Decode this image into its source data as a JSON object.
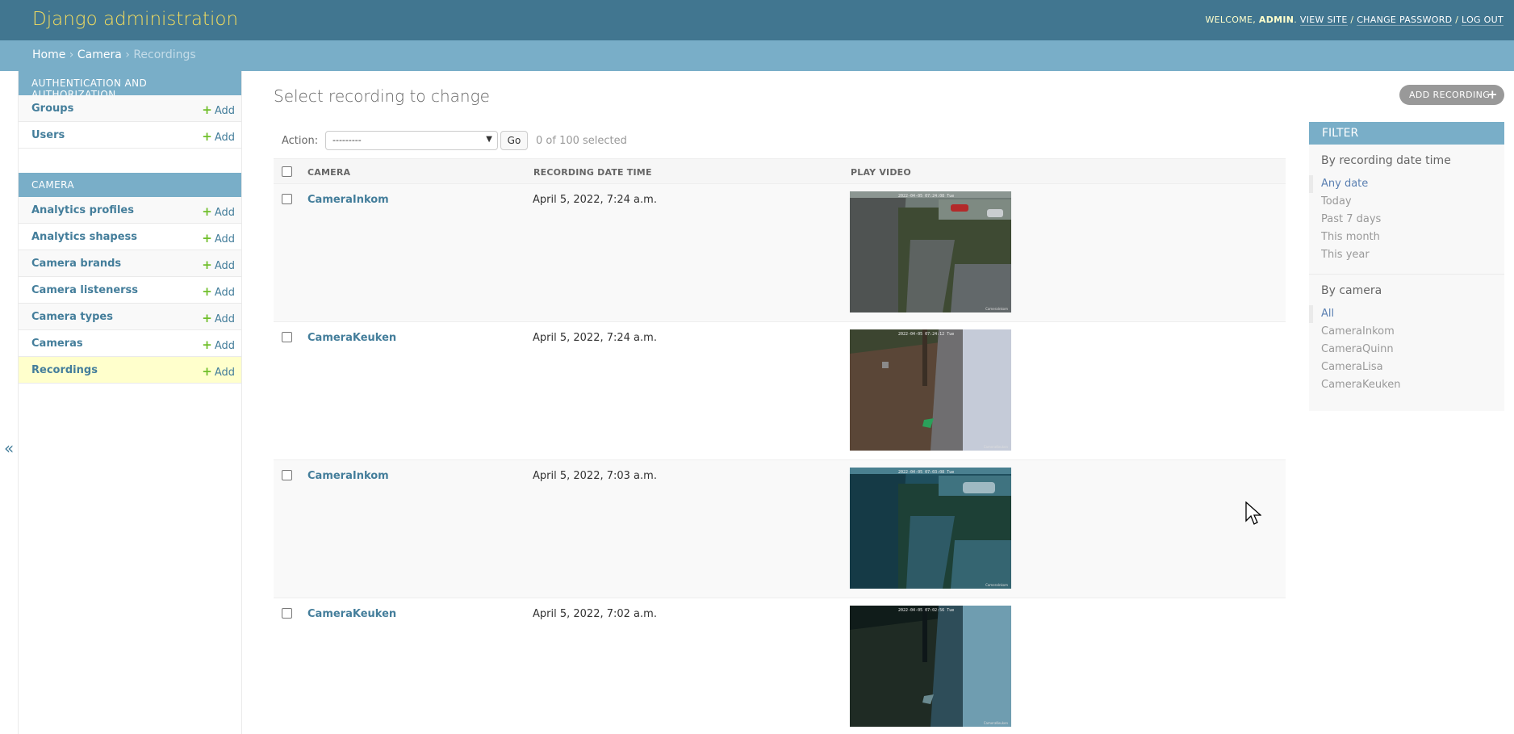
{
  "header": {
    "site_name": "Django administration",
    "welcome": "WELCOME,",
    "username": "ADMIN",
    "view_site": "VIEW SITE",
    "change_password": "CHANGE PASSWORD",
    "log_out": "LOG OUT",
    "separator": "/"
  },
  "breadcrumbs": {
    "home": "Home",
    "app": "Camera",
    "current": "Recordings",
    "sep": "›"
  },
  "nav_toggle": "«",
  "sidebar": {
    "add_label": "Add",
    "modules": [
      {
        "caption": "Authentication and Authorization",
        "models": [
          {
            "name": "Groups"
          },
          {
            "name": "Users"
          }
        ]
      },
      {
        "caption": "Camera",
        "models": [
          {
            "name": "Analytics profiles"
          },
          {
            "name": "Analytics shapess"
          },
          {
            "name": "Camera brands"
          },
          {
            "name": "Camera listenerss"
          },
          {
            "name": "Camera types"
          },
          {
            "name": "Cameras"
          },
          {
            "name": "Recordings",
            "current": true
          }
        ]
      }
    ]
  },
  "content": {
    "title": "Select recording to change",
    "add_button": "ADD RECORDING"
  },
  "actions": {
    "label": "Action:",
    "selected_option": "---------",
    "go_label": "Go",
    "selected_count": "0 of 100 selected"
  },
  "table": {
    "headers": [
      "CAMERA",
      "RECORDING DATE TIME",
      "PLAY VIDEO"
    ],
    "rows": [
      {
        "camera": "CameraInkom",
        "datetime": "April 5, 2022, 7:24 a.m.",
        "video_timestamp": "2022-04-05 07:24:08 Tue",
        "video_camera": "CameraInkom"
      },
      {
        "camera": "CameraKeuken",
        "datetime": "April 5, 2022, 7:24 a.m.",
        "video_timestamp": "2022-04-05 07:24:12 Tue",
        "video_camera": "CameraKeuken"
      },
      {
        "camera": "CameraInkom",
        "datetime": "April 5, 2022, 7:03 a.m.",
        "video_timestamp": "2022-04-05 07:03:08 Tue",
        "video_camera": "CameraInkom"
      },
      {
        "camera": "CameraKeuken",
        "datetime": "April 5, 2022, 7:02 a.m.",
        "video_timestamp": "2022-04-05 07:02:56 Tue",
        "video_camera": "CameraKeuken"
      }
    ]
  },
  "filter": {
    "title": "FILTER",
    "groups": [
      {
        "title": "By recording date time",
        "options": [
          "Any date",
          "Today",
          "Past 7 days",
          "This month",
          "This year"
        ],
        "selected": 0
      },
      {
        "title": "By camera",
        "options": [
          "All",
          "CameraInkom",
          "CameraQuinn",
          "CameraLisa",
          "CameraKeuken"
        ],
        "selected": 0
      }
    ]
  },
  "colors": {
    "header_bg": "#417690",
    "site_name": "#f5dd5d",
    "breadcrumbs_bg": "#79aec8",
    "link": "#447e9b",
    "add_plus": "#70bf2b",
    "current_row": "#ffffcc"
  }
}
